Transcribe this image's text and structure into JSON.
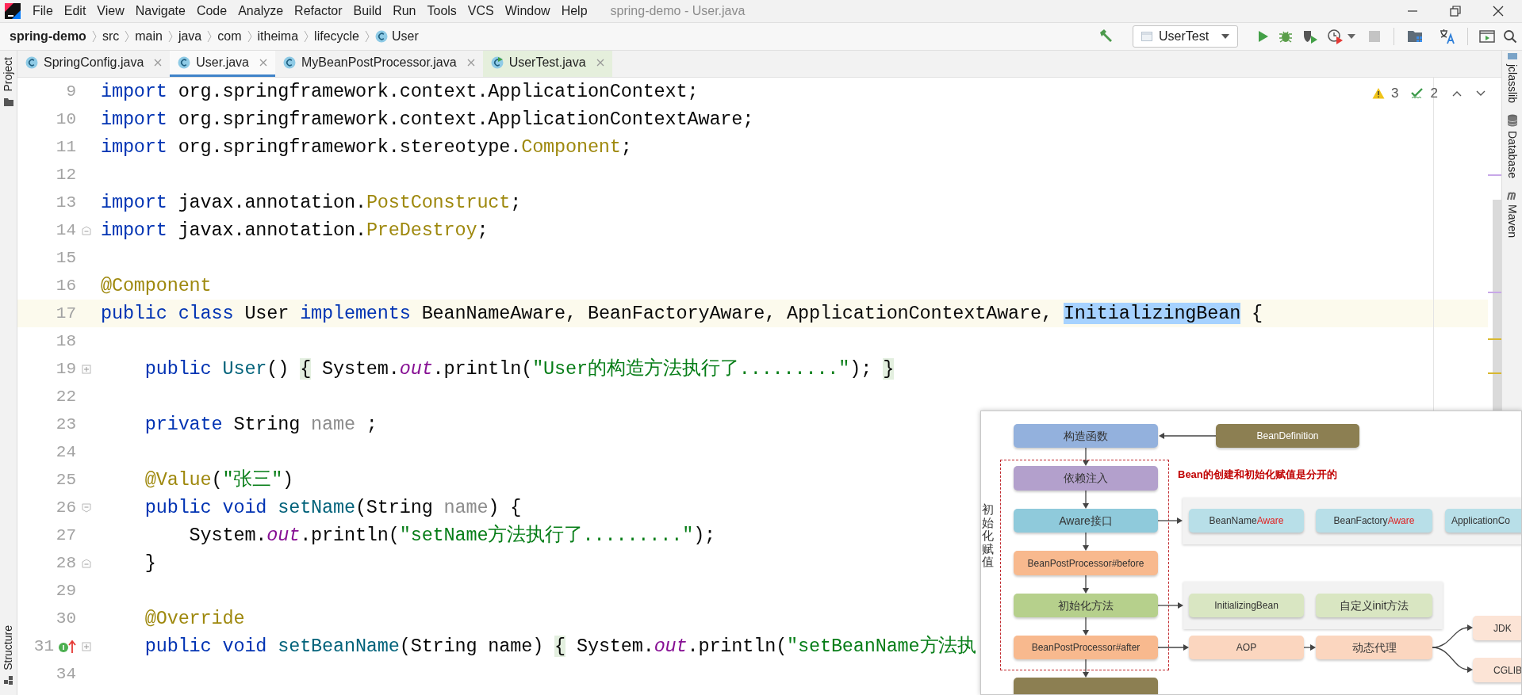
{
  "menu_bar": {
    "items": [
      "File",
      "Edit",
      "View",
      "Navigate",
      "Code",
      "Analyze",
      "Refactor",
      "Build",
      "Run",
      "Tools",
      "VCS",
      "Window",
      "Help"
    ],
    "title": "spring-demo - User.java"
  },
  "breadcrumbs": [
    {
      "label": "spring-demo",
      "kind": "project"
    },
    {
      "label": "src",
      "kind": "folder"
    },
    {
      "label": "main",
      "kind": "folder"
    },
    {
      "label": "java",
      "kind": "folder"
    },
    {
      "label": "com",
      "kind": "folder"
    },
    {
      "label": "itheima",
      "kind": "folder"
    },
    {
      "label": "lifecycle",
      "kind": "folder"
    },
    {
      "label": "User",
      "kind": "class"
    }
  ],
  "toolbar": {
    "run_configuration": "UserTest"
  },
  "tabs": [
    {
      "label": "SpringConfig.java",
      "kind": "class",
      "selected": false
    },
    {
      "label": "User.java",
      "kind": "class",
      "selected": true
    },
    {
      "label": "MyBeanPostProcessor.java",
      "kind": "class",
      "selected": false
    },
    {
      "label": "UserTest.java",
      "kind": "test",
      "selected": false
    }
  ],
  "left_tool_bar": [
    {
      "label": "Project",
      "kind": "project"
    },
    {
      "label": "Structure",
      "kind": "structure"
    }
  ],
  "right_tool_bar": [
    {
      "label": "jclasslib",
      "kind": "jclasslib"
    },
    {
      "label": "Database",
      "kind": "database"
    },
    {
      "label": "Maven",
      "kind": "maven"
    }
  ],
  "inspections": {
    "warnings": "3",
    "weak_warnings": "2"
  },
  "editor": {
    "lines": [
      {
        "number": "9",
        "tokens": [
          {
            "kind": "keyword",
            "text": "import "
          },
          {
            "kind": "plain",
            "text": "org.springframework.context.ApplicationContext;"
          }
        ]
      },
      {
        "number": "10",
        "tokens": [
          {
            "kind": "keyword",
            "text": "import "
          },
          {
            "kind": "plain",
            "text": "org.springframework.context.ApplicationContextAware;"
          }
        ]
      },
      {
        "number": "11",
        "tokens": [
          {
            "kind": "keyword",
            "text": "import "
          },
          {
            "kind": "plain",
            "text": "org.springframework.stereotype."
          },
          {
            "kind": "annotation",
            "text": "Component"
          },
          {
            "kind": "plain",
            "text": ";"
          }
        ]
      },
      {
        "number": "12"
      },
      {
        "number": "13",
        "tokens": [
          {
            "kind": "keyword",
            "text": "import "
          },
          {
            "kind": "plain",
            "text": "javax.annotation."
          },
          {
            "kind": "annotation",
            "text": "PostConstruct"
          },
          {
            "kind": "plain",
            "text": ";"
          }
        ]
      },
      {
        "number": "14",
        "fold": {
          "kind": "end"
        },
        "tokens": [
          {
            "kind": "keyword",
            "text": "import "
          },
          {
            "kind": "plain",
            "text": "javax.annotation."
          },
          {
            "kind": "annotation",
            "text": "PreDestroy"
          },
          {
            "kind": "plain",
            "text": ";"
          }
        ]
      },
      {
        "number": "15"
      },
      {
        "number": "16",
        "tokens": [
          {
            "kind": "annotation",
            "text": "@Component"
          }
        ]
      },
      {
        "number": "17",
        "current": true,
        "tokens": [
          {
            "kind": "keyword",
            "text": "public class "
          },
          {
            "kind": "plain",
            "text": "User "
          },
          {
            "kind": "keyword",
            "text": "implements "
          },
          {
            "kind": "plain",
            "text": "BeanNameAware, BeanFactoryAware, ApplicationContextAware, "
          },
          {
            "kind": "selected",
            "text": "InitializingBean"
          },
          {
            "kind": "plain",
            "text": " {"
          }
        ]
      },
      {
        "number": "18"
      },
      {
        "number": "19",
        "fold": {
          "kind": "collapsed"
        },
        "tokens": [
          {
            "kind": "keyword",
            "text": "    public "
          },
          {
            "kind": "method",
            "text": "User"
          },
          {
            "kind": "plain",
            "text": "() "
          },
          {
            "kind": "brace",
            "text": "{"
          },
          {
            "kind": "plain",
            "text": " System."
          },
          {
            "kind": "field",
            "text": "out"
          },
          {
            "kind": "plain",
            "text": ".println("
          },
          {
            "kind": "string",
            "text": "\"User的构造方法执行了.........\""
          },
          {
            "kind": "plain",
            "text": "); "
          },
          {
            "kind": "brace",
            "text": "}"
          }
        ]
      },
      {
        "number": "22"
      },
      {
        "number": "23",
        "tokens": [
          {
            "kind": "keyword",
            "text": "    private "
          },
          {
            "kind": "plain",
            "text": "String "
          },
          {
            "kind": "unused",
            "text": "name"
          },
          {
            "kind": "plain",
            "text": " ;"
          }
        ]
      },
      {
        "number": "24"
      },
      {
        "number": "25",
        "tokens": [
          {
            "kind": "annotation",
            "text": "    @Value"
          },
          {
            "kind": "plain",
            "text": "("
          },
          {
            "kind": "string",
            "text": "\"张三\""
          },
          {
            "kind": "plain",
            "text": ")"
          }
        ]
      },
      {
        "number": "26",
        "fold": {
          "kind": "start"
        },
        "tokens": [
          {
            "kind": "keyword",
            "text": "    public void "
          },
          {
            "kind": "method",
            "text": "setName"
          },
          {
            "kind": "plain",
            "text": "(String "
          },
          {
            "kind": "unused",
            "text": "name"
          },
          {
            "kind": "plain",
            "text": ") {"
          }
        ]
      },
      {
        "number": "27",
        "tokens": [
          {
            "kind": "plain",
            "text": "        System."
          },
          {
            "kind": "field",
            "text": "out"
          },
          {
            "kind": "plain",
            "text": ".println("
          },
          {
            "kind": "string",
            "text": "\"setName方法执行了.........\""
          },
          {
            "kind": "plain",
            "text": ");"
          }
        ]
      },
      {
        "number": "28",
        "fold": {
          "kind": "end"
        },
        "tokens": [
          {
            "kind": "plain",
            "text": "    }"
          }
        ]
      },
      {
        "number": "29"
      },
      {
        "number": "30",
        "tokens": [
          {
            "kind": "annotation",
            "text": "    @Override"
          }
        ]
      },
      {
        "number": "31",
        "fold": {
          "kind": "collapsed"
        },
        "gutter_icon": {
          "kind": "implements"
        },
        "tokens": [
          {
            "kind": "keyword",
            "text": "    public void "
          },
          {
            "kind": "method",
            "text": "setBeanName"
          },
          {
            "kind": "plain",
            "text": "(String name) "
          },
          {
            "kind": "brace",
            "text": "{"
          },
          {
            "kind": "plain",
            "text": " System."
          },
          {
            "kind": "field",
            "text": "out"
          },
          {
            "kind": "plain",
            "text": ".println("
          },
          {
            "kind": "string",
            "text": "\"setBeanName方法执"
          }
        ]
      },
      {
        "number": "34"
      }
    ]
  },
  "diagram": {
    "note": "Bean的创建和初始化赋值是分开的",
    "side_label": "初始化赋值",
    "nodes": [
      {
        "label": "构造函数",
        "kind": "step",
        "color": "#93b1dd"
      },
      {
        "label": "BeanDefinition",
        "kind": "source",
        "color": "#8c7f52"
      },
      {
        "label": "依赖注入",
        "kind": "step",
        "color": "#b3a0cc"
      },
      {
        "label": "Aware接口",
        "kind": "step",
        "color": "#8fcadb"
      },
      {
        "label": "BeanPostProcessor#before",
        "kind": "step",
        "color": "#f8b98e"
      },
      {
        "label": "初始化方法",
        "kind": "step",
        "color": "#b6d08c"
      },
      {
        "label": "BeanPostProcessor#after",
        "kind": "step",
        "color": "#f8b98e"
      },
      {
        "kind": "source",
        "color": "#8c7f52"
      },
      {
        "label": "BeanName",
        "accent": "Aware",
        "kind": "step",
        "color": "#b8dfe8"
      },
      {
        "label": "BeanFactory",
        "accent": "Aware",
        "kind": "step",
        "color": "#b8dfe8"
      },
      {
        "label": "ApplicationCo",
        "kind": "step",
        "color": "#b8dfe8"
      },
      {
        "label": "InitializingBean",
        "kind": "step",
        "color": "#d9e6c2"
      },
      {
        "label": "自定义init方法",
        "kind": "step",
        "color": "#d9e6c2"
      },
      {
        "label": "AOP",
        "kind": "step",
        "color": "#fbd6bf"
      },
      {
        "label": "动态代理",
        "kind": "step",
        "color": "#fbd6bf"
      },
      {
        "label": "JDK",
        "kind": "step",
        "color": "#fce4d6"
      },
      {
        "label": "CGLIB",
        "kind": "step",
        "color": "#fce4d6"
      }
    ]
  }
}
